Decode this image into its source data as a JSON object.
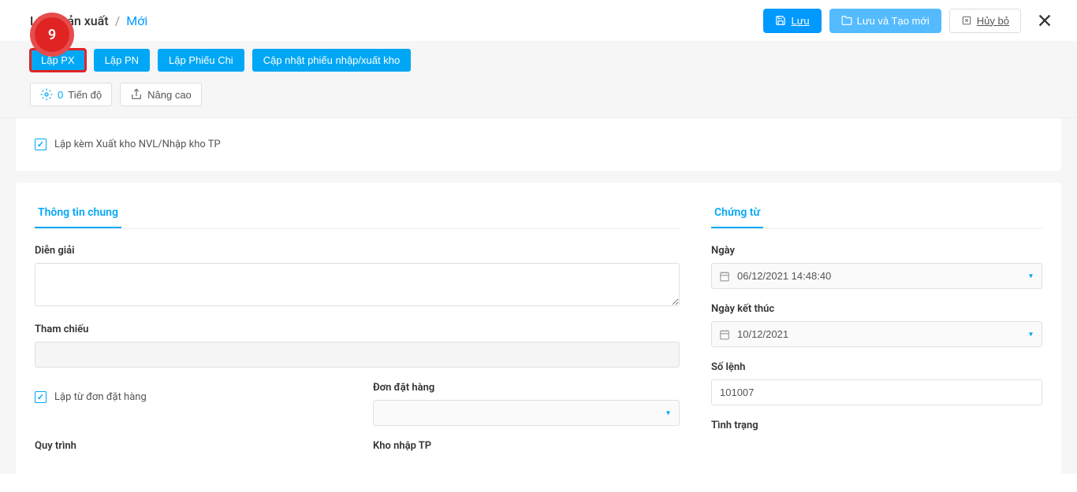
{
  "badge_number": "9",
  "breadcrumb": {
    "title": "Lệnh sản xuất",
    "sep": "/",
    "state": "Mới"
  },
  "header": {
    "save": "Lưu",
    "save_new": "Lưu và Tạo mới",
    "cancel": "Hủy bỏ"
  },
  "toolbar": {
    "lap_px": "Lập PX",
    "lap_pn": "Lập PN",
    "lap_phieu_chi": "Lập Phiếu Chi",
    "cap_nhat": "Cập nhật phiếu nhập/xuất kho",
    "progress_count": "0",
    "progress_label": "Tiến độ",
    "advanced": "Nâng cao"
  },
  "panel1": {
    "checkbox_label": "Lập kèm Xuất kho NVL/Nhập kho TP"
  },
  "tabs": {
    "general": "Thông tin chung",
    "document": "Chứng từ"
  },
  "general": {
    "description_label": "Diễn giải",
    "reference_label": "Tham chiếu",
    "from_order_label": "Lập từ đơn đặt hàng",
    "order_label": "Đơn đặt hàng",
    "process_label": "Quy trình",
    "warehouse_label": "Kho nhập TP"
  },
  "document": {
    "date_label": "Ngày",
    "date_value": "06/12/2021 14:48:40",
    "end_date_label": "Ngày kết thúc",
    "end_date_value": "10/12/2021",
    "order_no_label": "Số lệnh",
    "order_no_value": "101007",
    "status_label": "Tình trạng"
  }
}
